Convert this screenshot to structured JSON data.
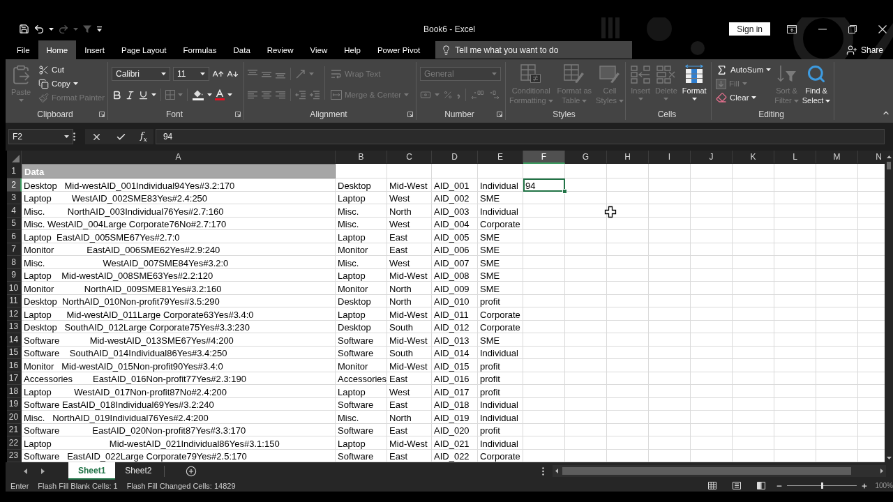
{
  "window": {
    "title": "Book6 - Excel",
    "sign_in": "Sign in"
  },
  "quick_access": {
    "save": {
      "disabled": false
    },
    "undo": {
      "disabled": false
    },
    "redo": {
      "disabled": true
    },
    "filter": {
      "disabled": true
    }
  },
  "menu": {
    "tabs": [
      {
        "label": "File",
        "selected": false
      },
      {
        "label": "Home",
        "selected": true
      },
      {
        "label": "Insert",
        "selected": false
      },
      {
        "label": "Page Layout",
        "selected": false
      },
      {
        "label": "Formulas",
        "selected": false
      },
      {
        "label": "Data",
        "selected": false
      },
      {
        "label": "Review",
        "selected": false
      },
      {
        "label": "View",
        "selected": false
      },
      {
        "label": "Help",
        "selected": false
      },
      {
        "label": "Power Pivot",
        "selected": false
      }
    ],
    "tell_me": {
      "placeholder": "Tell me what you want to do"
    },
    "share": "Share"
  },
  "ribbon": {
    "clipboard": {
      "label": "Clipboard",
      "paste": {
        "label": "Paste",
        "disabled": true
      },
      "cut": {
        "label": "Cut",
        "disabled": false
      },
      "copy": {
        "label": "Copy",
        "disabled": false
      },
      "format_painter": {
        "label": "Format Painter",
        "disabled": true
      }
    },
    "font": {
      "label": "Font",
      "font_name": "Calibri",
      "font_size": "11",
      "borders": {
        "disabled": true
      }
    },
    "alignment": {
      "label": "Alignment",
      "disabled": true,
      "wrap_text": "Wrap Text",
      "merge_center": "Merge & Center"
    },
    "number": {
      "label": "Number",
      "disabled": true,
      "format": "General"
    },
    "styles": {
      "label": "Styles",
      "disabled": true,
      "conditional_formatting": "Conditional\nFormatting",
      "format_as_table": "Format as\nTable",
      "cell_styles": "Cell\nStyles"
    },
    "cells": {
      "label": "Cells",
      "insert": {
        "label": "Insert",
        "disabled": true
      },
      "delete": {
        "label": "Delete",
        "disabled": true
      },
      "format": {
        "label": "Format",
        "disabled": false
      }
    },
    "editing": {
      "label": "Editing",
      "autosum": {
        "label": "AutoSum",
        "disabled": false
      },
      "fill": {
        "label": "Fill",
        "disabled": true
      },
      "clear": {
        "label": "Clear",
        "disabled": false
      },
      "sort_filter": {
        "label": "Sort &\nFilter",
        "disabled": true
      },
      "find_select": {
        "label": "Find &\nSelect",
        "disabled": false
      }
    }
  },
  "formula_bar": {
    "name_box": "F2",
    "function_button": "f$_{x}$",
    "formula": "94"
  },
  "columns": [
    {
      "label": "A",
      "selected": false
    },
    {
      "label": "B",
      "selected": false
    },
    {
      "label": "C",
      "selected": false
    },
    {
      "label": "D",
      "selected": false
    },
    {
      "label": "E",
      "selected": false
    },
    {
      "label": "F",
      "selected": true
    },
    {
      "label": "G",
      "selected": false
    },
    {
      "label": "H",
      "selected": false
    },
    {
      "label": "I",
      "selected": false
    },
    {
      "label": "J",
      "selected": false
    },
    {
      "label": "K",
      "selected": false
    },
    {
      "label": "L",
      "selected": false
    },
    {
      "label": "M",
      "selected": false
    },
    {
      "label": "N",
      "selected": false
    }
  ],
  "rows": [
    {
      "number": "1",
      "selected": false,
      "kind": "heading",
      "A": "Data"
    },
    {
      "number": "2",
      "selected": true,
      "kind": "data",
      "A": "Desktop   Mid-westAID_001Individual94Yes#3.2:170",
      "B": "Desktop",
      "C": "Mid-West",
      "D": "AID_001",
      "E": "Individual",
      "F": "94"
    },
    {
      "number": "3",
      "selected": false,
      "kind": "data",
      "A": "Laptop        WestAID_002SME83Yes#2.4:250",
      "B": "Laptop",
      "C": "West",
      "D": "AID_002",
      "E": "SME"
    },
    {
      "number": "4",
      "selected": false,
      "kind": "data",
      "A": "Misc.         NorthAID_003Individual76Yes#2.7:160",
      "B": "Misc.",
      "C": "North",
      "D": "AID_003",
      "E": "Individual"
    },
    {
      "number": "5",
      "selected": false,
      "kind": "data",
      "A": "Misc. WestAID_004Large Corporate76No#2.7:170",
      "B": "Misc.",
      "C": "West",
      "D": "AID_004",
      "E": "Corporate"
    },
    {
      "number": "6",
      "selected": false,
      "kind": "data",
      "A": "Laptop  EastAID_005SME67Yes#2.7:0",
      "B": "Laptop",
      "C": "East",
      "D": "AID_005",
      "E": "SME"
    },
    {
      "number": "7",
      "selected": false,
      "kind": "data",
      "A": "Monitor             EastAID_006SME62Yes#2.9:240",
      "B": "Monitor",
      "C": "East",
      "D": "AID_006",
      "E": "SME"
    },
    {
      "number": "8",
      "selected": false,
      "kind": "data",
      "A": "Misc.                       WestAID_007SME84Yes#3.2:0",
      "B": "Misc.",
      "C": "West",
      "D": "AID_007",
      "E": "SME"
    },
    {
      "number": "9",
      "selected": false,
      "kind": "data",
      "A": "Laptop    Mid-westAID_008SME63Yes#2.2:120",
      "B": "Laptop",
      "C": "Mid-West",
      "D": "AID_008",
      "E": "SME"
    },
    {
      "number": "10",
      "selected": false,
      "kind": "data",
      "A": "Monitor            NorthAID_009SME81Yes#3.2:160",
      "B": "Monitor",
      "C": "North",
      "D": "AID_009",
      "E": "SME"
    },
    {
      "number": "11",
      "selected": false,
      "kind": "data",
      "A": "Desktop  NorthAID_010Non-profit79Yes#3.5:290",
      "B": "Desktop",
      "C": "North",
      "D": "AID_010",
      "E": "profit"
    },
    {
      "number": "12",
      "selected": false,
      "kind": "data",
      "A": "Laptop      Mid-westAID_011Large Corporate63Yes#3.4:0",
      "B": "Laptop",
      "C": "Mid-West",
      "D": "AID_011",
      "E": "Corporate"
    },
    {
      "number": "13",
      "selected": false,
      "kind": "data",
      "A": "Desktop   SouthAID_012Large Corporate75Yes#3.3:230",
      "B": "Desktop",
      "C": "South",
      "D": "AID_012",
      "E": "Corporate"
    },
    {
      "number": "14",
      "selected": false,
      "kind": "data",
      "A": "Software            Mid-westAID_013SME67Yes#4:200",
      "B": "Software",
      "C": "Mid-West",
      "D": "AID_013",
      "E": "SME"
    },
    {
      "number": "15",
      "selected": false,
      "kind": "data",
      "A": "Software    SouthAID_014Individual86Yes#3.4:250",
      "B": "Software",
      "C": "South",
      "D": "AID_014",
      "E": "Individual"
    },
    {
      "number": "16",
      "selected": false,
      "kind": "data",
      "A": "Monitor   Mid-westAID_015Non-profit90Yes#3.4:0",
      "B": "Monitor",
      "C": "Mid-West",
      "D": "AID_015",
      "E": "profit"
    },
    {
      "number": "17",
      "selected": false,
      "kind": "data",
      "A": "Accessories        EastAID_016Non-profit77Yes#2.3:190",
      "B": "Accessories",
      "C": "East",
      "D": "AID_016",
      "E": "profit"
    },
    {
      "number": "18",
      "selected": false,
      "kind": "data",
      "A": "Laptop         WestAID_017Non-profit87No#2.4:200",
      "B": "Laptop",
      "C": "West",
      "D": "AID_017",
      "E": "profit"
    },
    {
      "number": "19",
      "selected": false,
      "kind": "data",
      "A": "Software EastAID_018Individual69Yes#3.2:240",
      "B": "Software",
      "C": "East",
      "D": "AID_018",
      "E": "Individual"
    },
    {
      "number": "20",
      "selected": false,
      "kind": "data",
      "A": "Misc.   NorthAID_019Individual76Yes#2.4:200",
      "B": "Misc.",
      "C": "North",
      "D": "AID_019",
      "E": "Individual"
    },
    {
      "number": "21",
      "selected": false,
      "kind": "data",
      "A": "Software             EastAID_020Non-profit87Yes#3.3:170",
      "B": "Software",
      "C": "East",
      "D": "AID_020",
      "E": "profit"
    },
    {
      "number": "22",
      "selected": false,
      "kind": "data",
      "A": "Laptop                       Mid-westAID_021Individual86Yes#3.1:150",
      "B": "Laptop",
      "C": "Mid-West",
      "D": "AID_021",
      "E": "Individual"
    },
    {
      "number": "23",
      "selected": false,
      "kind": "data",
      "A": "Software   EastAID_022Large Corporate79Yes#2.5:170",
      "B": "Software",
      "C": "East",
      "D": "AID_022",
      "E": "Corporate"
    }
  ],
  "sheet_tabs": [
    {
      "label": "Sheet1",
      "selected": true
    },
    {
      "label": "Sheet2",
      "selected": false
    }
  ],
  "status_bar": {
    "mode": "Enter",
    "messages": [
      "Flash Fill Blank Cells: 1",
      "Flash Fill Changed Cells: 14829"
    ],
    "zoom": {
      "reading": "100%",
      "level": 0.5
    }
  }
}
